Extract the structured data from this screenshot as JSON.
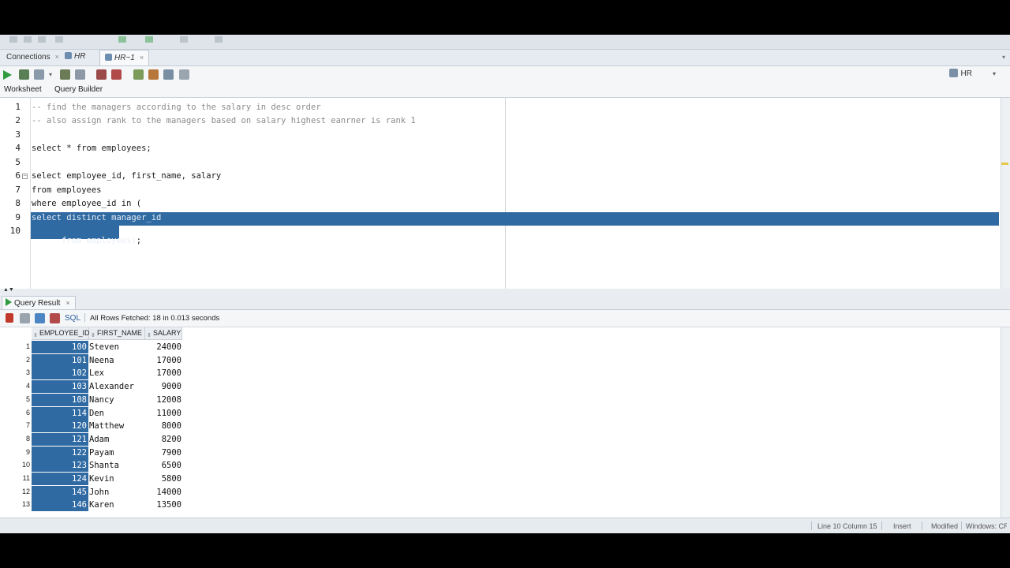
{
  "tabs": {
    "connections": "Connections",
    "hr": "HR",
    "hr1": "HR~1"
  },
  "schema_selector": {
    "label": "HR"
  },
  "subtabs": {
    "worksheet": "Worksheet",
    "query_builder": "Query Builder"
  },
  "editor": {
    "lines": [
      "-- find the managers according to the salary in desc order",
      "-- also assign rank to the managers based on salary highest eanrner is rank 1",
      "",
      "select * from employees;",
      "",
      "select employee_id, first_name, salary",
      "from employees",
      "where employee_id in (",
      "select distinct manager_id",
      "from employees);"
    ],
    "line_numbers": [
      "1",
      "2",
      "3",
      "4",
      "5",
      "6",
      "7",
      "8",
      "9",
      "10"
    ]
  },
  "results": {
    "tab_label": "Query Result",
    "sql_label": "SQL",
    "fetch_status": "All Rows Fetched: 18 in 0.013 seconds",
    "columns": [
      "EMPLOYEE_ID",
      "FIRST_NAME",
      "SALARY"
    ],
    "rows": [
      {
        "n": "1",
        "id": "100",
        "name": "Steven",
        "salary": "24000"
      },
      {
        "n": "2",
        "id": "101",
        "name": "Neena",
        "salary": "17000"
      },
      {
        "n": "3",
        "id": "102",
        "name": "Lex",
        "salary": "17000"
      },
      {
        "n": "4",
        "id": "103",
        "name": "Alexander",
        "salary": "9000"
      },
      {
        "n": "5",
        "id": "108",
        "name": "Nancy",
        "salary": "12008"
      },
      {
        "n": "6",
        "id": "114",
        "name": "Den",
        "salary": "11000"
      },
      {
        "n": "7",
        "id": "120",
        "name": "Matthew",
        "salary": "8000"
      },
      {
        "n": "8",
        "id": "121",
        "name": "Adam",
        "salary": "8200"
      },
      {
        "n": "9",
        "id": "122",
        "name": "Payam",
        "salary": "7900"
      },
      {
        "n": "10",
        "id": "123",
        "name": "Shanta",
        "salary": "6500"
      },
      {
        "n": "11",
        "id": "124",
        "name": "Kevin",
        "salary": "5800"
      },
      {
        "n": "12",
        "id": "145",
        "name": "John",
        "salary": "14000"
      },
      {
        "n": "13",
        "id": "146",
        "name": "Karen",
        "salary": "13500"
      }
    ]
  },
  "status": {
    "position": "Line 10 Column 15",
    "mode": "Insert",
    "state": "Modified",
    "eol": "Windows: CR"
  },
  "colors": {
    "selection": "#2f6aa3",
    "run_green": "#2e9b3f"
  }
}
